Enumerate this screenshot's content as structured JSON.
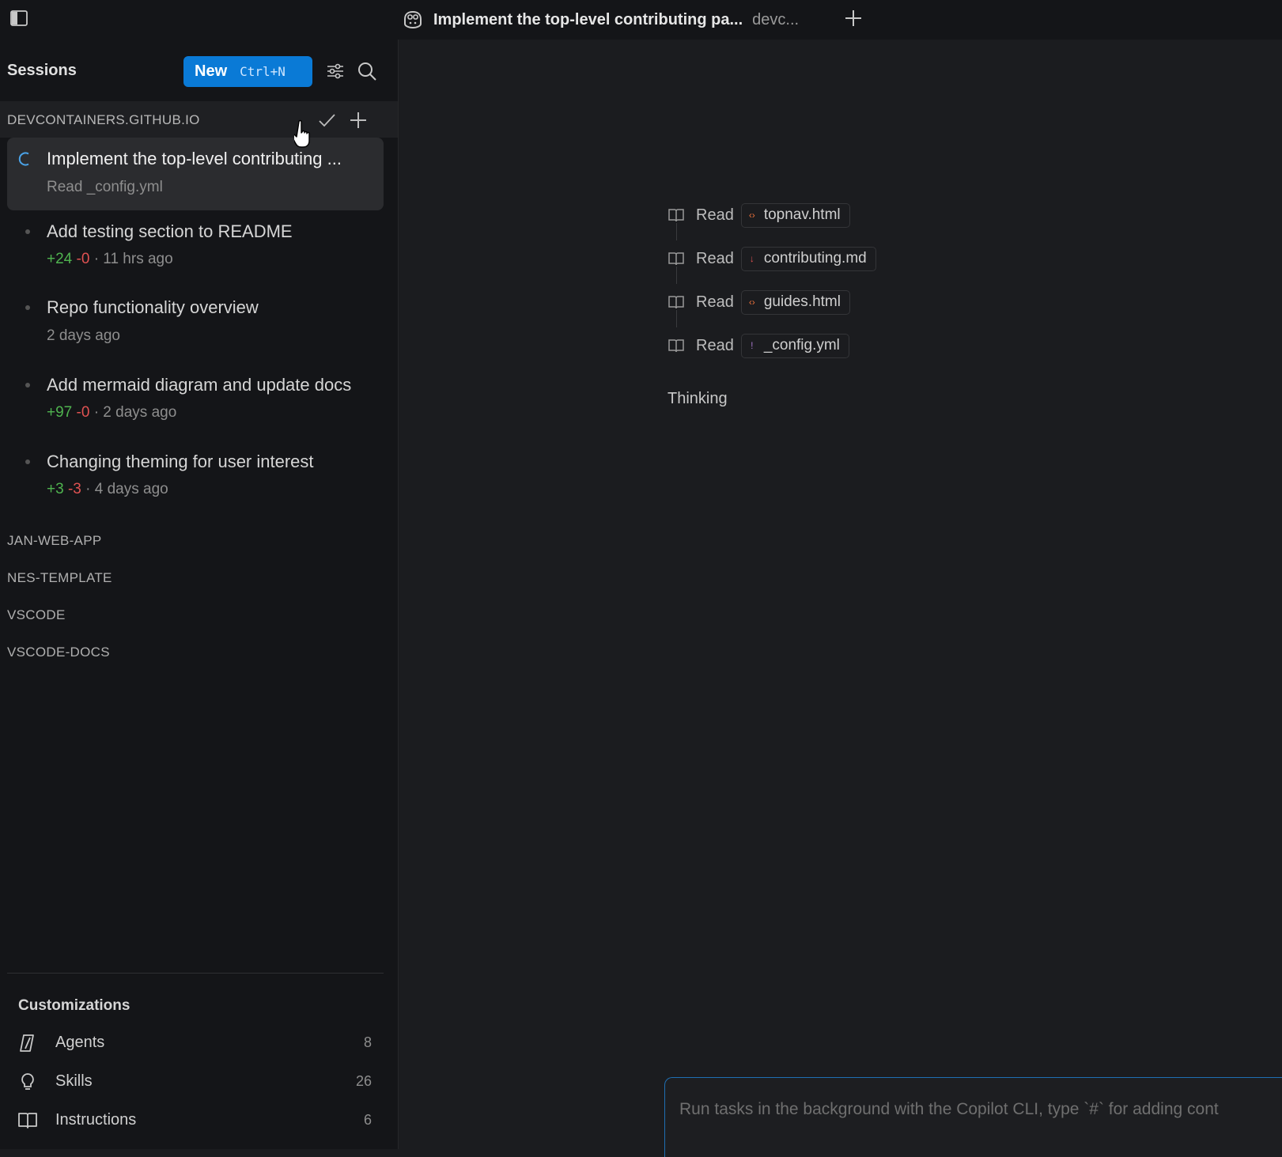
{
  "tab": {
    "title": "Implement the top-level contributing pa...",
    "subtitle": "devc..."
  },
  "sidebar": {
    "sessions_title": "Sessions",
    "new_button": {
      "label": "New",
      "shortcut": "Ctrl+N"
    },
    "group": {
      "label": "DEVCONTAINERS.GITHUB.IO",
      "sessions": [
        {
          "title": "Implement the top-level contributing ...",
          "meta": "Read _config.yml",
          "active": true
        },
        {
          "title": "Add testing section to README",
          "added": "+24",
          "removed": "-0",
          "time": "· 11 hrs ago"
        },
        {
          "title": "Repo functionality overview",
          "time": "2 days ago"
        },
        {
          "title": "Add mermaid diagram and update docs",
          "added": "+97",
          "removed": "-0",
          "time": "· 2 days ago"
        },
        {
          "title": "Changing theming for user interest",
          "added": "+3",
          "removed": "-3",
          "time": "· 4 days ago"
        }
      ]
    },
    "repos": [
      "JAN-WEB-APP",
      "NES-TEMPLATE",
      "VSCODE",
      "VSCODE-DOCS"
    ],
    "customizations": {
      "title": "Customizations",
      "items": [
        {
          "label": "Agents",
          "count": "8",
          "icon": "agents-icon"
        },
        {
          "label": "Skills",
          "count": "26",
          "icon": "lightbulb-icon"
        },
        {
          "label": "Instructions",
          "count": "6",
          "icon": "book-icon"
        }
      ]
    }
  },
  "main": {
    "steps": [
      {
        "label": "Read",
        "file": "topnav.html",
        "glyph": "‹›",
        "glyph_color": "#e8703a"
      },
      {
        "label": "Read",
        "file": "contributing.md",
        "glyph": "↓",
        "glyph_color": "#e05252"
      },
      {
        "label": "Read",
        "file": "guides.html",
        "glyph": "‹›",
        "glyph_color": "#e8703a"
      },
      {
        "label": "Read",
        "file": "_config.yml",
        "glyph": "!",
        "glyph_color": "#a074c4"
      }
    ],
    "thinking": "Thinking",
    "input_placeholder": "Run tasks in the background with the Copilot CLI, type `#` for adding cont"
  },
  "colors": {
    "accent": "#0a7ad6",
    "added": "#4fb34f",
    "removed": "#e05252"
  }
}
